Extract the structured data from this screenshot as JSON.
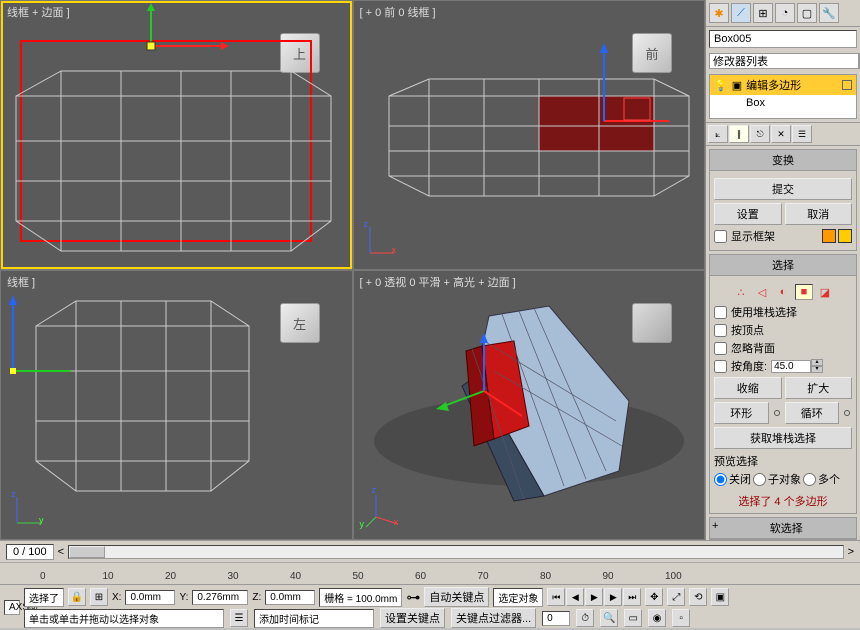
{
  "viewports": {
    "top": {
      "label": "线框 + 边面 ]",
      "cube": "上"
    },
    "front": {
      "label": "[ + 0 前 0 线框 ]",
      "cube": "前"
    },
    "left": {
      "label": "线框 ]",
      "cube": "左"
    },
    "persp": {
      "label": "[ + 0 透视 0 平滑 + 高光 + 边面 ]",
      "cube": ""
    }
  },
  "right": {
    "object_name": "Box005",
    "modifier_list": "修改器列表",
    "stack": {
      "edit_poly": "编辑多边形",
      "box": "Box"
    },
    "tabs": {
      "changes": "变换",
      "commit": "提交",
      "settings": "设置",
      "cancel": "取消",
      "show_cage": "显示框架",
      "selection": "选择",
      "use_stack": "使用堆栈选择",
      "by_vertex": "按顶点",
      "ignore_back": "忽略背面",
      "by_angle": "按角度:",
      "angle_val": "45.0",
      "shrink": "收缩",
      "grow": "扩大",
      "ring": "环形",
      "loop": "循环",
      "get_stack": "获取堆栈选择",
      "preview_sel": "预览选择",
      "off": "关闭",
      "subobj": "子对象",
      "multi": "多个",
      "sel_count": "选择了 4 个多边形",
      "soft_sel": "软选择"
    }
  },
  "timeline": {
    "range": "0 / 100",
    "ticks": [
      "0",
      "10",
      "20",
      "30",
      "40",
      "50",
      "60",
      "70",
      "80",
      "90",
      "100"
    ]
  },
  "status": {
    "sel": "选择了",
    "x_lbl": "X:",
    "x_val": "0.0mm",
    "y_lbl": "Y:",
    "y_val": "0.276mm",
    "z_lbl": "Z:",
    "z_val": "0.0mm",
    "grid": "栅格 = 100.0mm",
    "autokey": "自动关键点",
    "selobj": "选定对象",
    "hint": "单击或单击并拖动以选择对象",
    "addtime": "添加时间标记",
    "setkey": "设置关键点",
    "keyfilter": "关键点过滤器...",
    "axis": "AXS◎"
  }
}
